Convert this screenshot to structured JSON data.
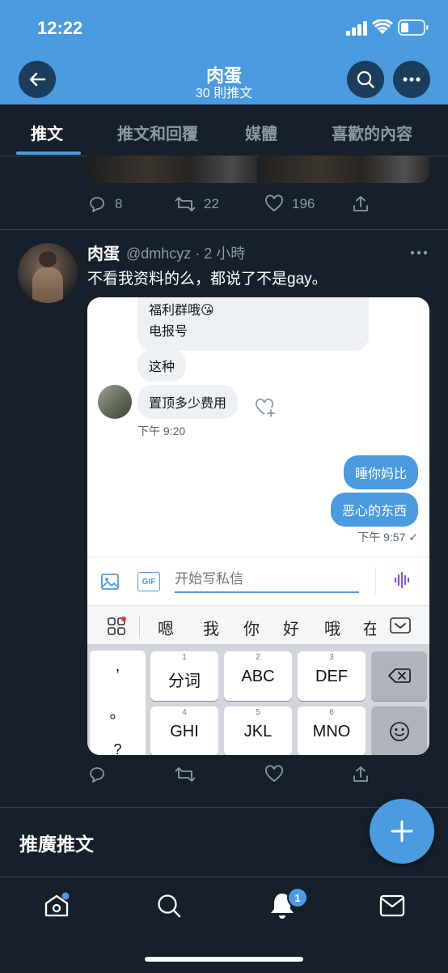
{
  "status_bar": {
    "time": "12:22"
  },
  "header": {
    "title": "肉蛋",
    "subtitle": "30 則推文"
  },
  "tabs": [
    {
      "label": "推文",
      "active": true
    },
    {
      "label": "推文和回覆",
      "active": false
    },
    {
      "label": "媒體",
      "active": false
    },
    {
      "label": "喜歡的內容",
      "active": false
    }
  ],
  "prev_tweet": {
    "replies": "8",
    "retweets": "22",
    "likes": "196"
  },
  "tweet": {
    "name": "肉蛋",
    "handle_time": "@dmhcyz · 2 小時",
    "text": "不看我资料的么，都说了不是gay。",
    "embedded": {
      "bubble_1_line1": "福利群哦😘",
      "bubble_1_line2": "电报号",
      "bubble_2": "这种",
      "bubble_3": "置顶多少费用",
      "time_left": "下午 9:20",
      "reply_1": "睡你妈比",
      "reply_2": "恶心的东西",
      "time_right": "下午 9:57 ✓",
      "composer_placeholder": "开始写私信",
      "gif_label": "GIF",
      "suggestions": [
        "嗯",
        "我",
        "你",
        "好",
        "哦",
        "在"
      ],
      "keyboard": {
        "punct": [
          ",",
          "。",
          "?"
        ],
        "row1": [
          {
            "num": "1",
            "label": "分词"
          },
          {
            "num": "2",
            "label": "ABC"
          },
          {
            "num": "3",
            "label": "DEF"
          }
        ],
        "row2": [
          {
            "num": "4",
            "label": "GHI"
          },
          {
            "num": "5",
            "label": "JKL"
          },
          {
            "num": "6",
            "label": "MNO"
          }
        ]
      }
    }
  },
  "promoted": {
    "label": "推廣推文"
  },
  "bottom_nav": {
    "notifications_badge": "1"
  },
  "colors": {
    "accent": "#4a9bdf",
    "background": "#15202b",
    "muted": "#8b98a5"
  }
}
